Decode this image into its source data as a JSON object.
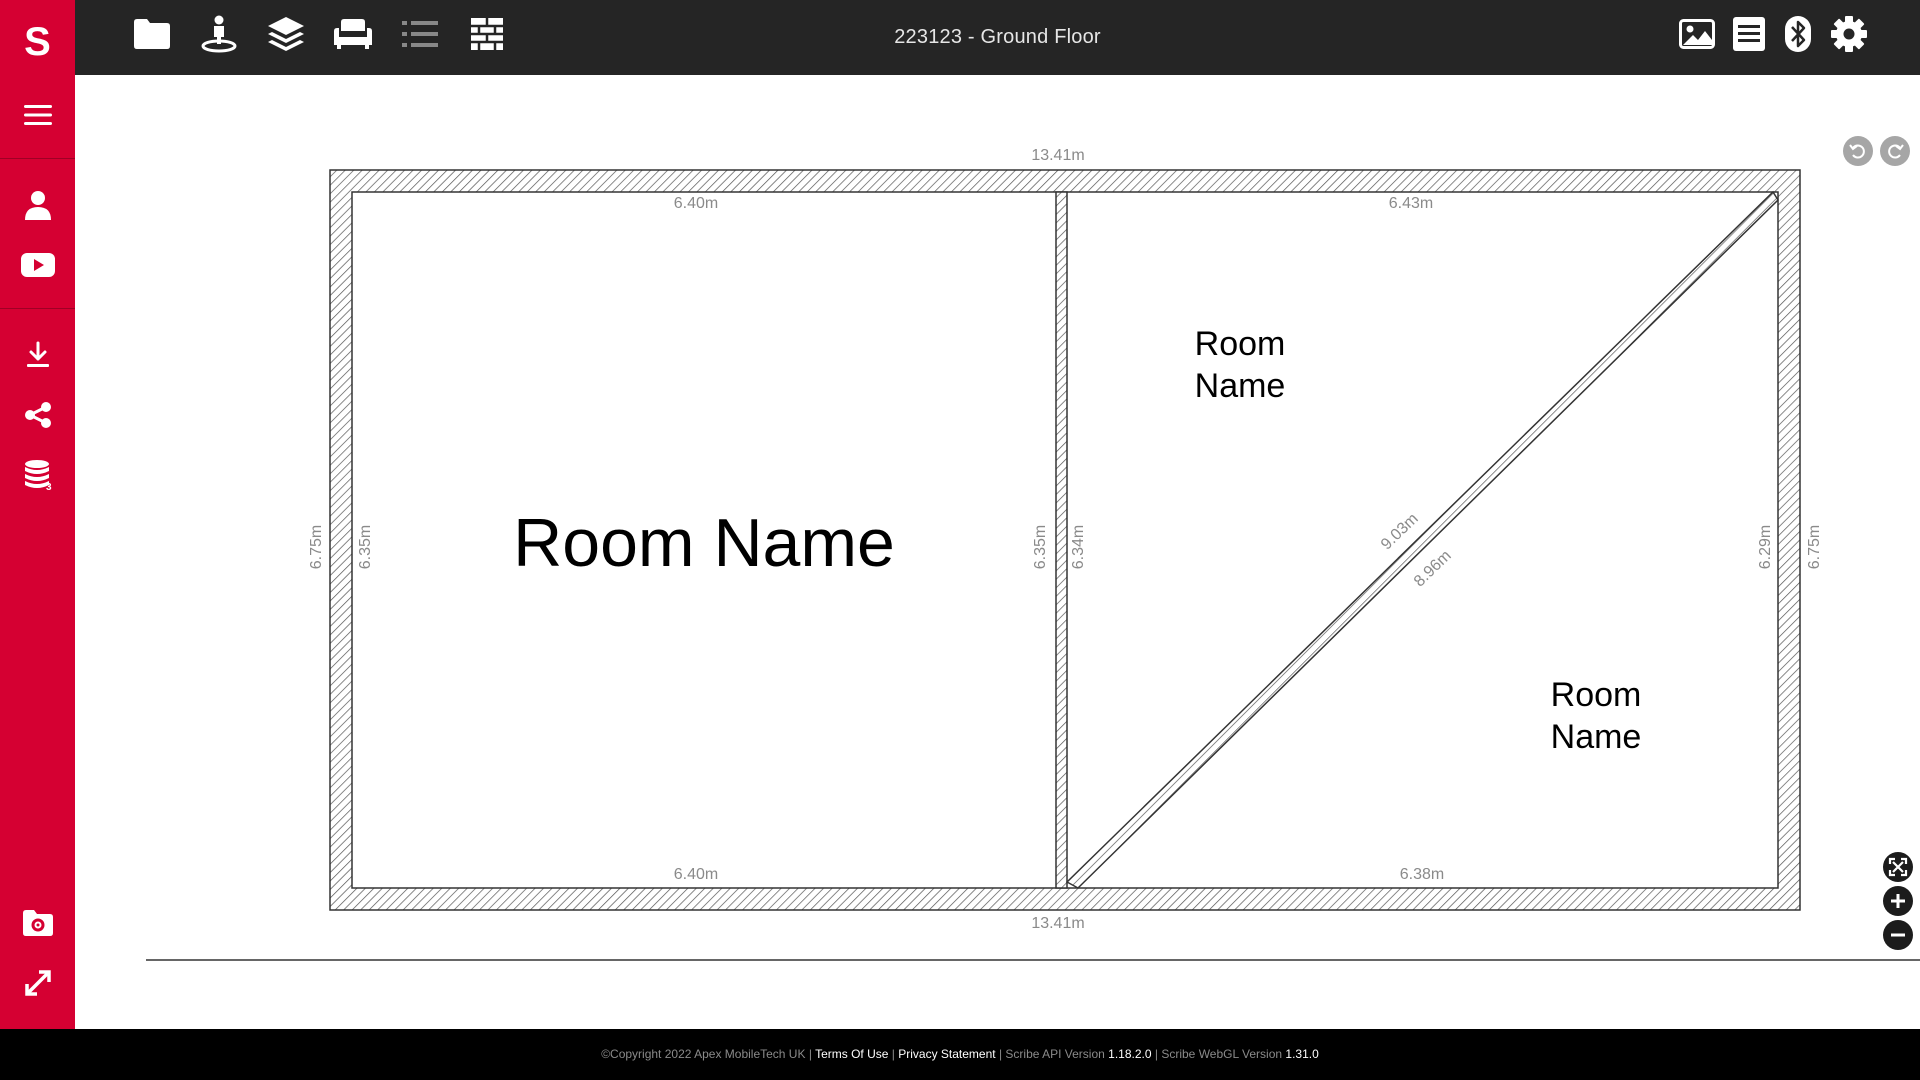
{
  "app": {
    "logo": "S",
    "title": "223123  - Ground Floor"
  },
  "sidebar": {
    "items": [
      {
        "name": "menu-icon",
        "label": "Menu"
      },
      {
        "name": "user-icon",
        "label": "User"
      },
      {
        "name": "youtube-icon",
        "label": "Videos"
      },
      {
        "name": "download-icon",
        "label": "Download"
      },
      {
        "name": "share-icon",
        "label": "Share"
      },
      {
        "name": "coins-icon",
        "label": "Credits",
        "badge": "3"
      },
      {
        "name": "folder-settings-icon",
        "label": "Project Settings"
      },
      {
        "name": "expand-icon",
        "label": "Fullscreen"
      }
    ]
  },
  "toolbar": {
    "left_icons": [
      "folder-icon",
      "person-location-icon",
      "layers-icon",
      "sofa-icon",
      "list-icon",
      "brick-wall-icon"
    ],
    "right_icons": [
      "image-icon",
      "document-icon",
      "bluetooth-icon",
      "gear-icon"
    ]
  },
  "floorplan": {
    "outer_top": "13.41m",
    "outer_bottom": "13.41m",
    "outer_left": "6.75m",
    "outer_right": "6.75m",
    "room1": {
      "label": "Room Name",
      "top": "6.40m",
      "bottom": "6.40m",
      "left": "6.35m",
      "right": "6.35m"
    },
    "room2": {
      "label_line1": "Room",
      "label_line2": "Name",
      "top": "6.43m",
      "left": "6.34m",
      "diag": "9.03m"
    },
    "room3": {
      "label_line1": "Room",
      "label_line2": "Name",
      "bottom": "6.38m",
      "right": "6.29m",
      "diag": "8.96m"
    }
  },
  "footer": {
    "copyright": "©Copyright 2022 Apex MobileTech UK",
    "sep": "|",
    "terms": "Terms Of Use",
    "privacy": "Privacy Statement",
    "api_label": "Scribe API Version",
    "api_version": "1.18.2.0",
    "webgl_label": "Scribe WebGL Version",
    "webgl_version": "1.31.0"
  },
  "colors": {
    "sidebar": "#d50032",
    "topbar": "#252525",
    "footer": "#000000",
    "dimension_text": "#8a8a8a"
  }
}
